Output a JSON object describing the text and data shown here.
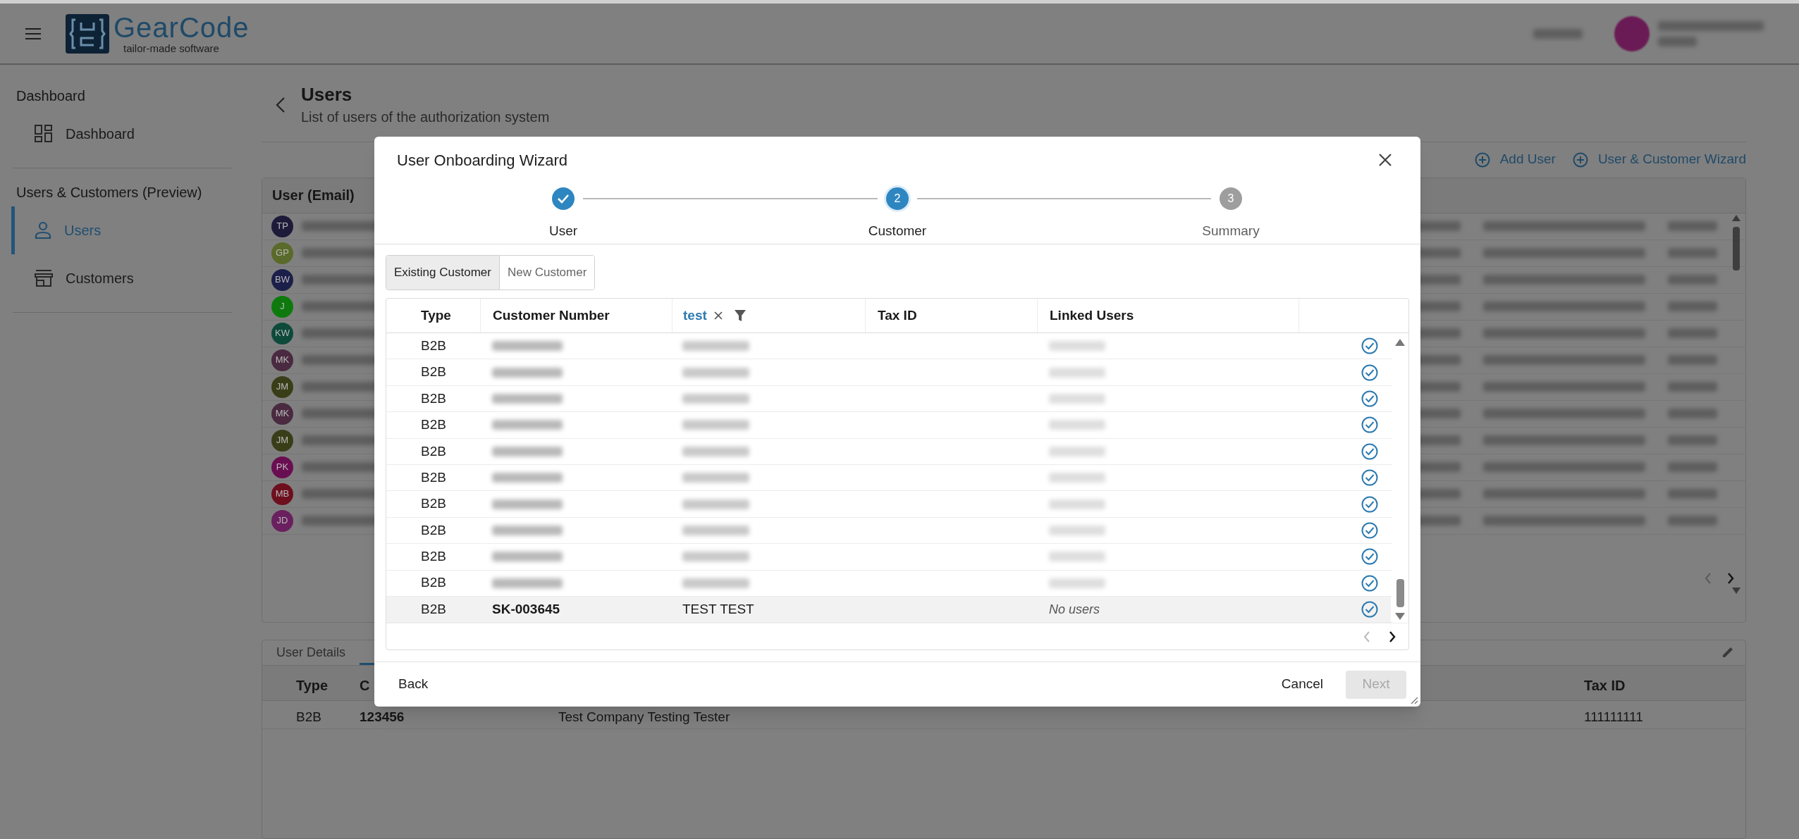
{
  "header": {
    "logo_name": "GearCode",
    "logo_tagline": "tailor-made software"
  },
  "sidebar": {
    "sections": [
      {
        "heading": "Dashboard",
        "items": [
          {
            "label": "Dashboard",
            "kind": "grid",
            "selected": false
          }
        ]
      },
      {
        "heading": "Users & Customers (Preview)",
        "items": [
          {
            "label": "Users",
            "kind": "person",
            "selected": true
          },
          {
            "label": "Customers",
            "kind": "store",
            "selected": false
          }
        ]
      }
    ]
  },
  "page": {
    "title": "Users",
    "subtitle": "List of users of the authorization system",
    "actions": [
      "Add User",
      "User & Customer Wizard"
    ]
  },
  "users_table": {
    "columns": [
      "User (Email)"
    ],
    "rows": [
      {
        "initials": "TP",
        "color": "#1e1a3a"
      },
      {
        "initials": "GP",
        "color": "#5a6a2a"
      },
      {
        "initials": "BW",
        "color": "#1c1f4a"
      },
      {
        "initials": "J",
        "color": "#0e7a0e"
      },
      {
        "initials": "KW",
        "color": "#0d4a3a"
      },
      {
        "initials": "MK",
        "color": "#4a2a40"
      },
      {
        "initials": "JM",
        "color": "#3a3e18"
      },
      {
        "initials": "MK",
        "color": "#4a2a40"
      },
      {
        "initials": "JM",
        "color": "#3a3e18"
      },
      {
        "initials": "PK",
        "color": "#6a0e52"
      },
      {
        "initials": "MB",
        "color": "#6e0f1e"
      },
      {
        "initials": "JD",
        "color": "#6a1f5e"
      }
    ]
  },
  "details": {
    "tabs": [
      {
        "label": "User Details",
        "selected": false
      }
    ],
    "columns": [
      "Type",
      "C",
      "",
      "Tax ID"
    ],
    "rows": [
      {
        "cells": [
          "B2B",
          "123456",
          "Test Company Testing Tester",
          "111111111"
        ]
      }
    ]
  },
  "dialog": {
    "title": "User Onboarding Wizard",
    "steps": [
      {
        "label": "User",
        "completed": true,
        "selected": false
      },
      {
        "label": "Customer",
        "number": "2",
        "completed": false,
        "selected": true
      },
      {
        "label": "Summary",
        "number": "3",
        "completed": false,
        "selected": false
      }
    ],
    "toggle": [
      {
        "label": "Existing Customer",
        "selected": true
      },
      {
        "label": "New Customer",
        "selected": false
      }
    ],
    "table": {
      "columns": [
        {
          "label": "Type",
          "kind": "plain"
        },
        {
          "label": "Customer Number",
          "kind": "plain"
        },
        {
          "label": "test",
          "kind": "filter"
        },
        {
          "label": "Tax ID",
          "kind": "plain"
        },
        {
          "label": "Linked Users",
          "kind": "plain"
        }
      ],
      "rows": [
        {
          "type": "B2B",
          "selected": false
        },
        {
          "type": "B2B",
          "selected": false
        },
        {
          "type": "B2B",
          "selected": false
        },
        {
          "type": "B2B",
          "selected": false
        },
        {
          "type": "B2B",
          "selected": false
        },
        {
          "type": "B2B",
          "selected": false
        },
        {
          "type": "B2B",
          "selected": false
        },
        {
          "type": "B2B",
          "selected": false
        },
        {
          "type": "B2B",
          "selected": false
        },
        {
          "type": "B2B",
          "selected": false
        },
        {
          "type": "B2B",
          "customer_number": "SK-003645",
          "name": "TEST TEST",
          "linked_users": "No users",
          "selected": true
        }
      ]
    },
    "back": "Back",
    "cancel": "Cancel",
    "next": {
      "label": "Next",
      "disabled": true
    }
  }
}
